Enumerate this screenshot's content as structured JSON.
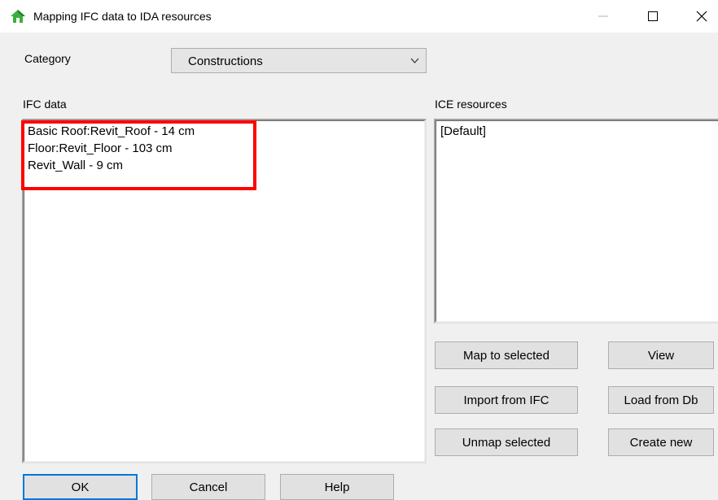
{
  "window": {
    "title": "Mapping IFC data to IDA resources",
    "controls": {
      "minimize": "—",
      "maximize": "☐",
      "close": "✕"
    }
  },
  "category": {
    "label": "Category",
    "selected": "Constructions"
  },
  "ifc": {
    "label": "IFC data",
    "items": [
      "Basic Roof:Revit_Roof - 14 cm",
      "Floor:Revit_Floor - 103 cm",
      "Revit_Wall - 9 cm"
    ]
  },
  "ice": {
    "label": "ICE resources",
    "items": [
      "[Default]"
    ]
  },
  "actions": {
    "map_to_selected": "Map to selected",
    "view": "View",
    "import_from_ifc": "Import from IFC",
    "load_from_db": "Load from Db",
    "unmap_selected": "Unmap selected",
    "create_new": "Create new"
  },
  "footer": {
    "ok": "OK",
    "cancel": "Cancel",
    "help": "Help"
  },
  "colors": {
    "highlight": "#ff0000",
    "default_button_border": "#0078d7",
    "dialog_bg": "#f0f0f0"
  }
}
